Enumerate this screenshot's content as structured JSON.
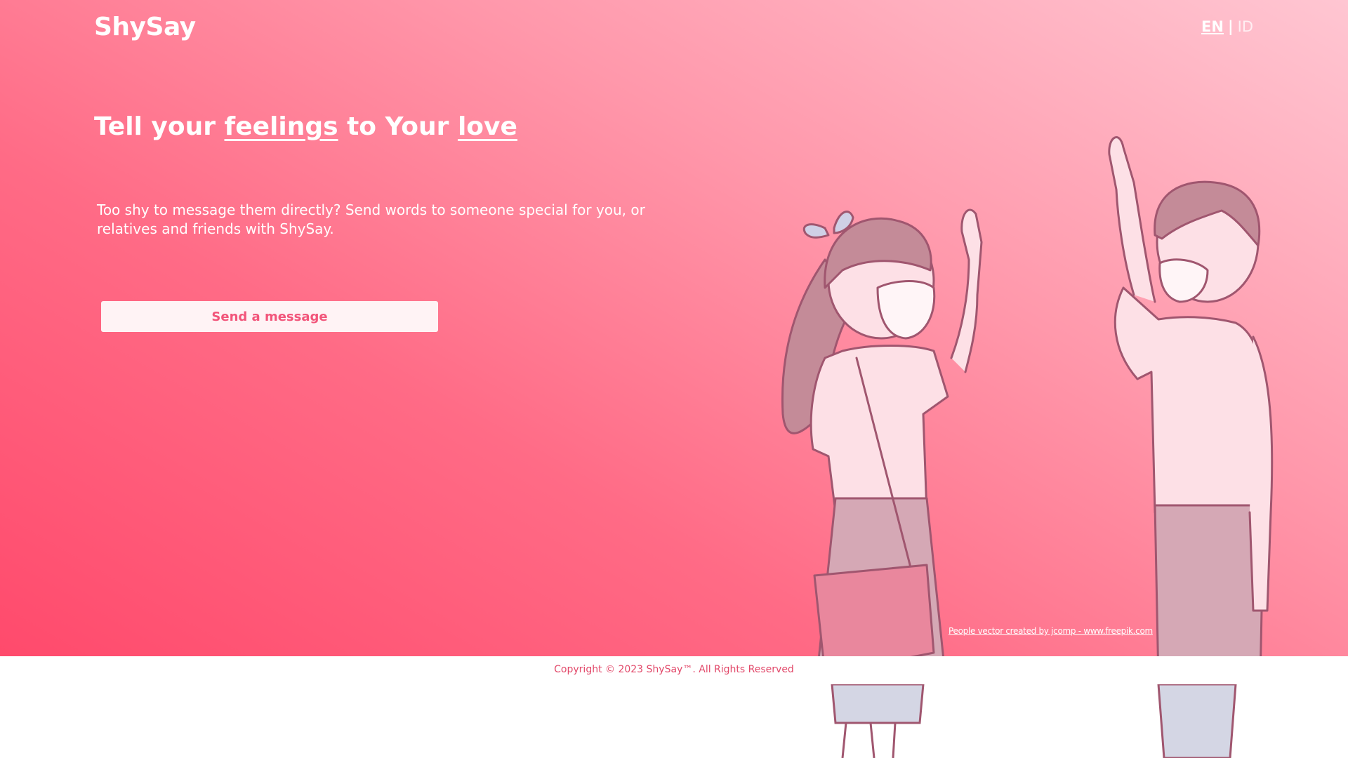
{
  "header": {
    "logo": "ShySay",
    "lang": {
      "en": "EN",
      "separator": "|",
      "id": "ID"
    }
  },
  "hero": {
    "headline": {
      "part1": "Tell your ",
      "highlight1": "feelings",
      "part2": " to Your ",
      "highlight2": "love"
    },
    "description": "Too shy to message them directly? Send words to someone special for you, or relatives and friends with ShySay.",
    "cta_label": "Send a message",
    "credit": "People vector created by jcomp - www.freepik.com"
  },
  "footer": {
    "copyright": "Copyright © 2023 ShySay™. All Rights Reserved"
  },
  "colors": {
    "gradient_start": "#ff4a6c",
    "gradient_end": "#ffc6d2",
    "accent": "#f2557a"
  },
  "icons": {
    "illustration": "couple-high-five-illustration"
  }
}
